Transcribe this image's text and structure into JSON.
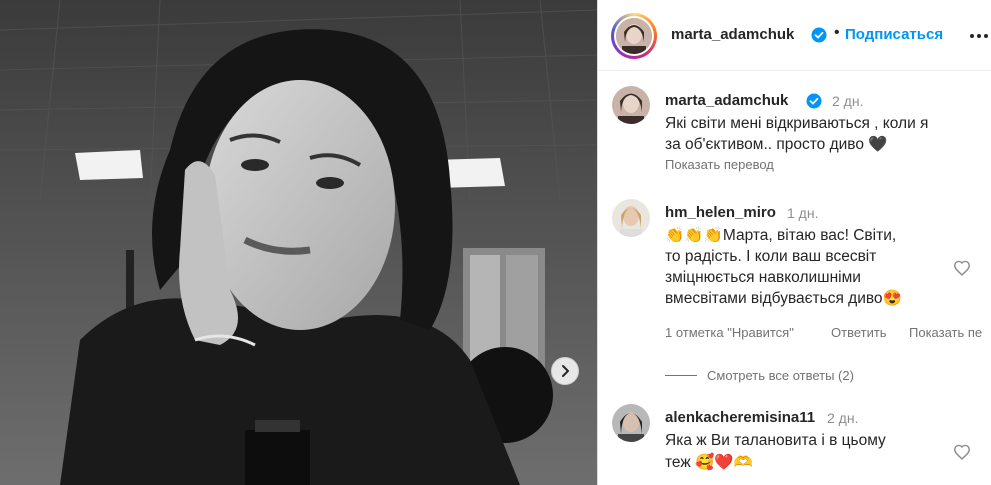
{
  "header": {
    "username": "marta_adamchuk",
    "follow_label": "Подписаться"
  },
  "caption": {
    "username": "marta_adamchuk",
    "time": "2 дн.",
    "text_line1": "Які світи мені відкриваються , коли я",
    "text_line2": "за об'єктивом.. просто диво 🖤",
    "translate": "Показать перевод"
  },
  "comments": [
    {
      "username": "hm_helen_miro",
      "time": "1 дн.",
      "lines": [
        "👏👏👏Марта, вітаю вас! Світи,",
        "то радість. І коли ваш всесвіт",
        "зміцнюється навколишніми",
        "вмесвітами відбувається диво😍"
      ],
      "likes": "1 отметка \"Нравится\"",
      "reply": "Ответить",
      "translate": "Показать пе",
      "view_replies": "Смотреть все ответы (2)"
    },
    {
      "username": "alenkacheremisina11",
      "time": "2 дн.",
      "lines": [
        "Яка ж Ви талановита і в цьому",
        "теж 🥰❤️🫶"
      ]
    }
  ],
  "colors": {
    "accent": "#0095f6",
    "verified": "#0095f6"
  }
}
